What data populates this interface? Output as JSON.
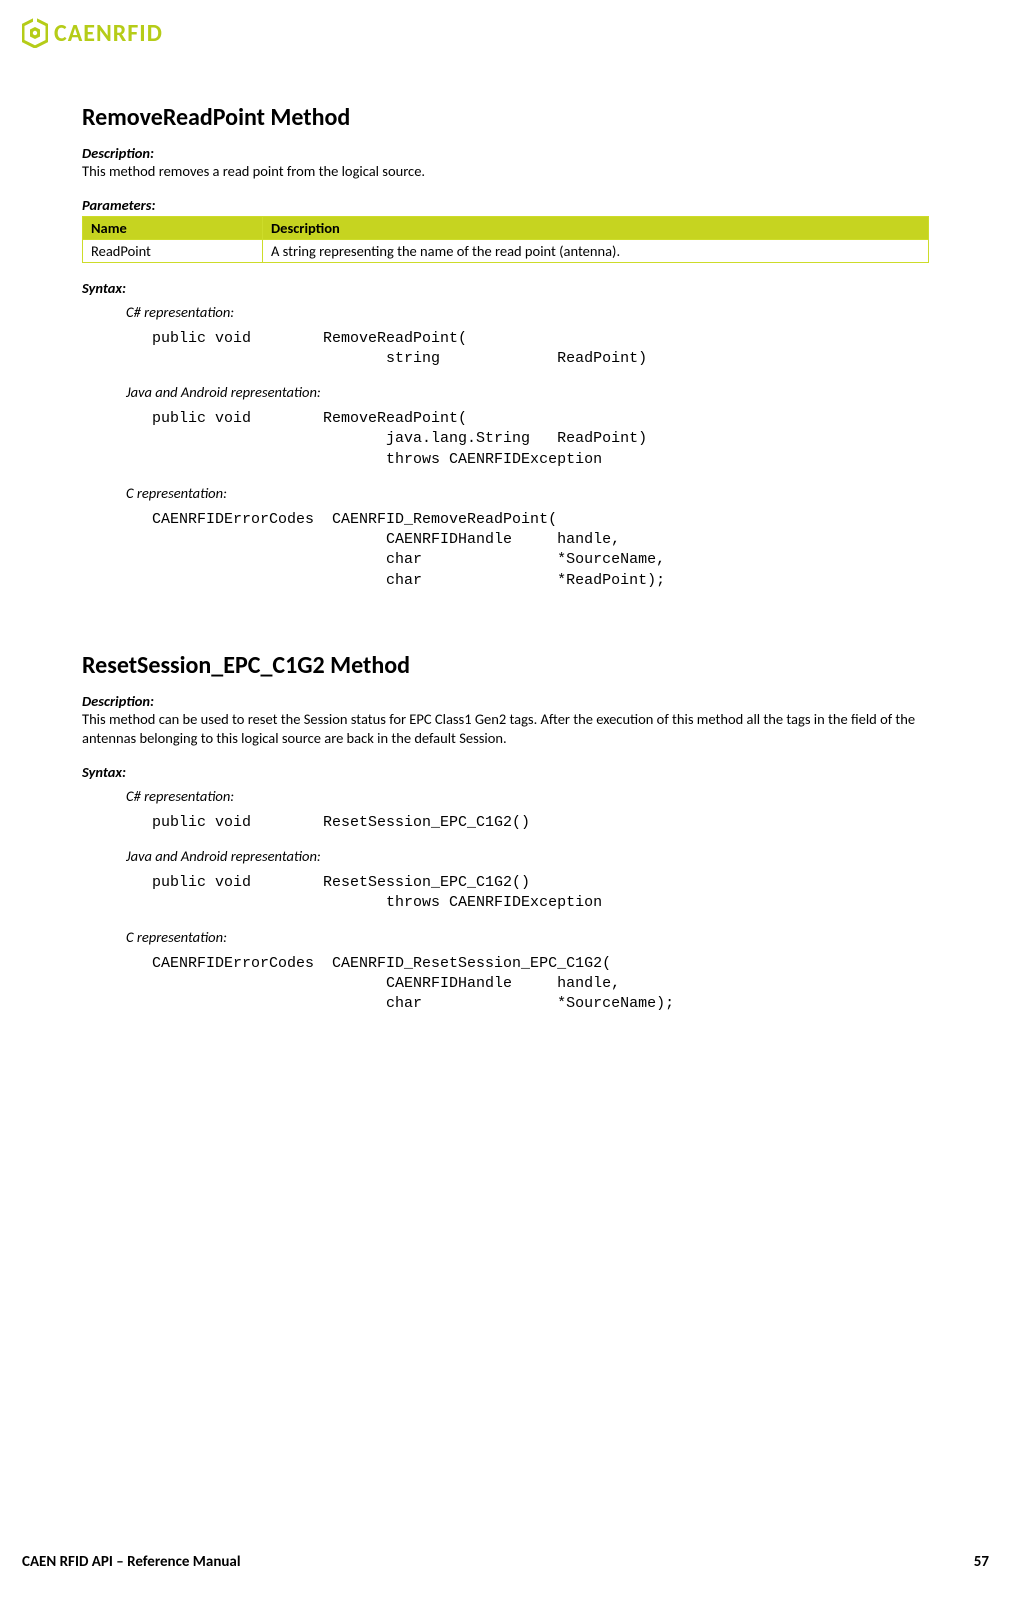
{
  "header": {
    "brand": "CAENRFID"
  },
  "methods": [
    {
      "title": "RemoveReadPoint Method",
      "description_label": "Description:",
      "description": "This method removes a read point from the logical source.",
      "parameters_label": "Parameters:",
      "param_table": {
        "headers": [
          "Name",
          "Description"
        ],
        "rows": [
          [
            "ReadPoint",
            "A string representing the name of the read point (antenna)."
          ]
        ]
      },
      "syntax_label": "Syntax:",
      "reps": [
        {
          "label": "C# representation:",
          "code": "public void        RemoveReadPoint(\n                          string             ReadPoint)"
        },
        {
          "label": "Java and Android representation:",
          "code": "public void        RemoveReadPoint(\n                          java.lang.String   ReadPoint)\n                          throws CAENRFIDException"
        },
        {
          "label": "C representation:",
          "code": "CAENRFIDErrorCodes  CAENRFID_RemoveReadPoint(\n                          CAENRFIDHandle     handle,\n                          char               *SourceName,\n                          char               *ReadPoint);"
        }
      ]
    },
    {
      "title": "ResetSession_EPC_C1G2 Method",
      "description_label": "Description:",
      "description": "This method can be used to reset the Session status for EPC Class1 Gen2 tags. After the execution of this method all the tags in the field of the antennas belonging to this logical source are back in the default Session.",
      "syntax_label": "Syntax:",
      "reps": [
        {
          "label": "C# representation:",
          "code": "public void        ResetSession_EPC_C1G2()"
        },
        {
          "label": "Java and Android representation:",
          "code": "public void        ResetSession_EPC_C1G2()\n                          throws CAENRFIDException"
        },
        {
          "label": "C representation:",
          "code": "CAENRFIDErrorCodes  CAENRFID_ResetSession_EPC_C1G2(\n                          CAENRFIDHandle     handle,\n                          char               *SourceName);"
        }
      ]
    }
  ],
  "footer": {
    "left": "CAEN RFID API – Reference Manual",
    "right": "57"
  }
}
